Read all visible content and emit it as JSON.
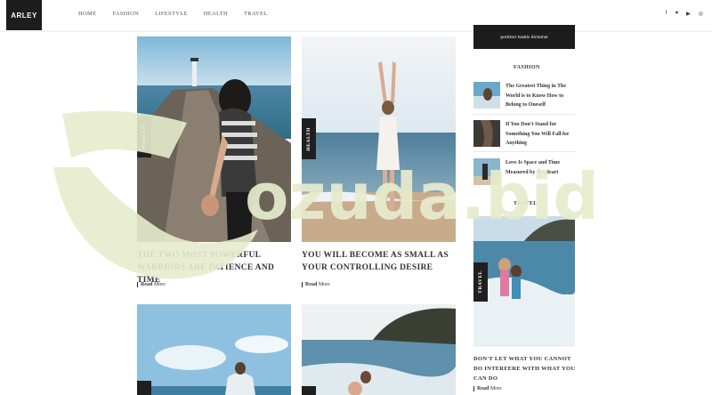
{
  "header": {
    "logo": "ARLEY",
    "nav": [
      "HOME",
      "FASHION",
      "LIFESTYLE",
      "HEALTH",
      "TRAVEL"
    ],
    "social_icons": [
      "facebook-icon",
      "twitter-icon",
      "youtube-icon",
      "instagram-icon"
    ]
  },
  "posts": [
    {
      "category": "HEALTH",
      "title": "THE TWO MOST POWERFUL WARRIORS ARE PATIENCE AND TIME",
      "read_bold": "Read",
      "read_rest": " More"
    },
    {
      "category": "HEALTH",
      "title": "YOU WILL BECOME AS SMALL AS YOUR CONTROLLING DESIRE",
      "read_bold": "Read",
      "read_rest": " More"
    }
  ],
  "sidebar": {
    "promo": "porttitor mattis dictumst",
    "fashion_heading": "FASHION",
    "fashion_items": [
      "The Greatest Thing in The World is to Know How to Belong to Oneself",
      "If You Don't Stand for Something You Will Fall for Anything",
      "Love Is Space and Time Measured by the Heart"
    ],
    "travel_heading": "TRAVEL",
    "travel_tag": "TRAVEL",
    "travel_title": "DON'T LET WHAT YOU CANNOT DO INTERFERE WITH WHAT YOU CAN DO",
    "travel_read_bold": "Read",
    "travel_read_rest": " More"
  },
  "watermark": "ozuda.bid",
  "colors": {
    "accent_dark": "#1d1d1d",
    "watermark": "#e7eccd"
  }
}
